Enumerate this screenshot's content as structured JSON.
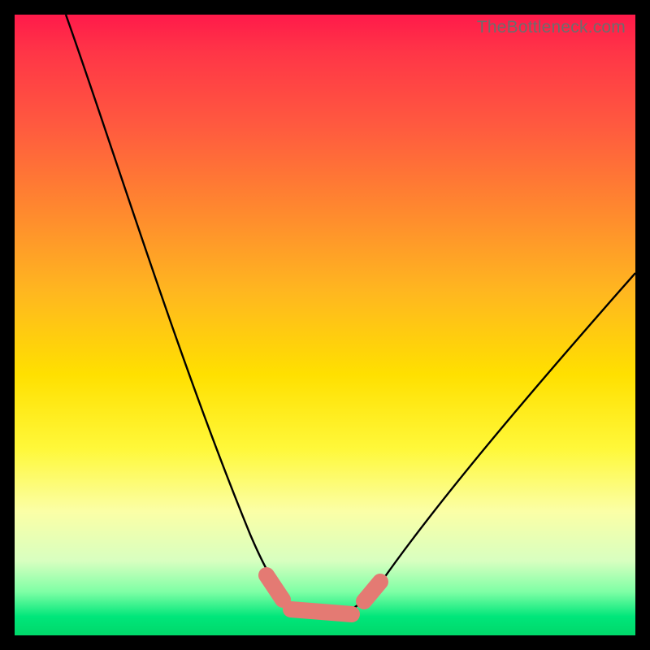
{
  "watermark": "TheBottleneck.com",
  "chart_data": {
    "type": "line",
    "title": "",
    "xlabel": "",
    "ylabel": "",
    "xlim": [
      0,
      100
    ],
    "ylim": [
      0,
      100
    ],
    "series": [
      {
        "name": "bottleneck-curve",
        "x": [
          8,
          12,
          16,
          20,
          24,
          28,
          32,
          36,
          40,
          43,
          46,
          49,
          52,
          55,
          60,
          65,
          70,
          75,
          80,
          85,
          90,
          95,
          100
        ],
        "values": [
          100,
          90,
          80,
          70,
          60,
          50,
          40,
          30,
          20,
          12,
          6,
          4,
          3,
          4,
          6,
          11,
          18,
          26,
          34,
          42,
          49,
          55,
          60
        ]
      }
    ],
    "markers": {
      "color": "#e47a73",
      "points_x": [
        43,
        46,
        49,
        52,
        55
      ],
      "points_y": [
        12,
        6,
        4,
        3,
        4
      ]
    }
  }
}
